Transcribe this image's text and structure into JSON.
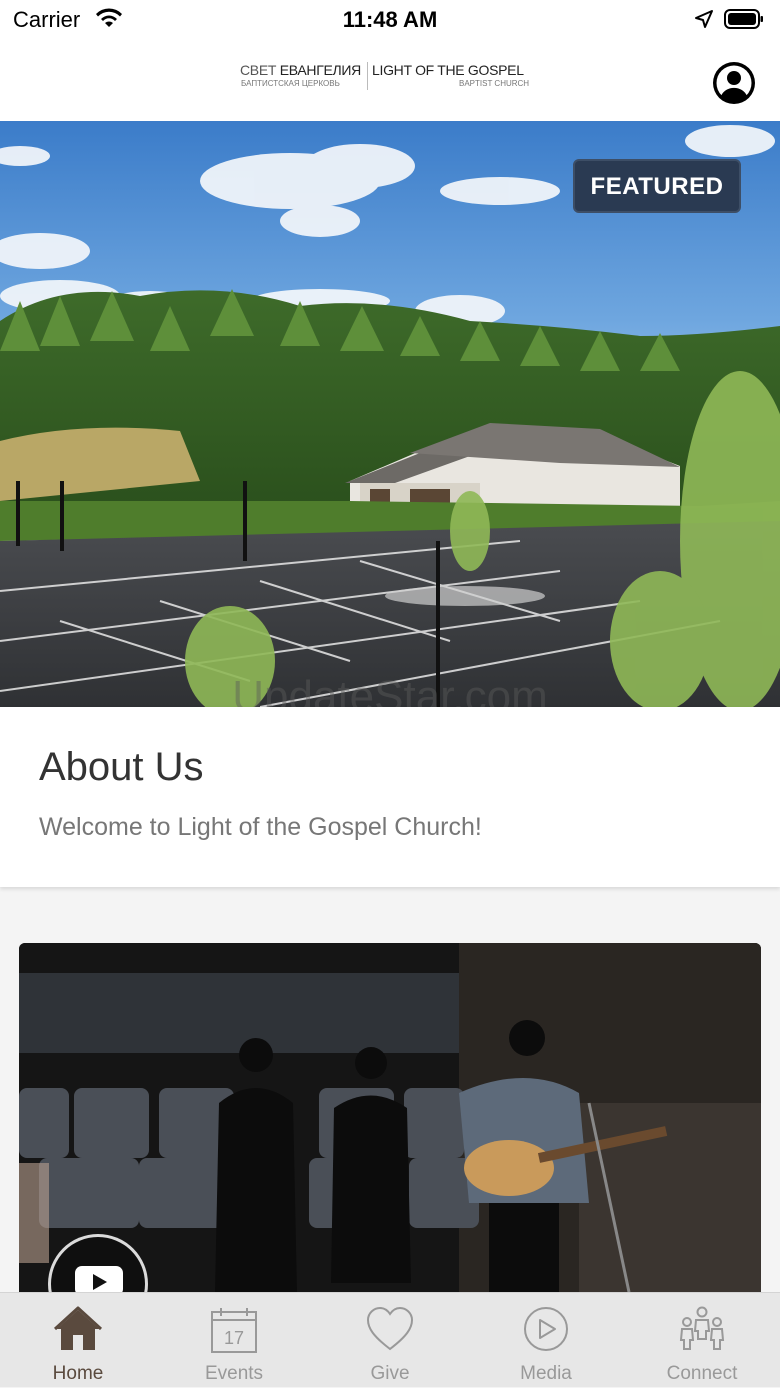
{
  "status_bar": {
    "carrier": "Carrier",
    "time": "11:48 AM"
  },
  "header": {
    "logo": {
      "ru_title_light": "СВЕТ ",
      "ru_title_bold": "ЕВАНГЕЛИЯ",
      "ru_subtitle": "БАПТИСТСКАЯ ЦЕРКОВЬ",
      "en_title": "LIGHT OF THE GOSPEL",
      "en_subtitle": "BAPTIST CHURCH"
    },
    "profile_icon": "person-circle-icon"
  },
  "hero": {
    "badge": "FEATURED",
    "watermark": "UpdateStar.com"
  },
  "about": {
    "title": "About Us",
    "subtitle": "Welcome to Light of the Gospel Church!"
  },
  "video": {
    "play_icon": "youtube-play-icon"
  },
  "tabs": [
    {
      "label": "Home",
      "icon": "home-icon",
      "active": true
    },
    {
      "label": "Events",
      "icon": "calendar-icon",
      "calendar_day": "17",
      "active": false
    },
    {
      "label": "Give",
      "icon": "heart-icon",
      "active": false
    },
    {
      "label": "Media",
      "icon": "play-circle-icon",
      "active": false
    },
    {
      "label": "Connect",
      "icon": "people-icon",
      "active": false
    }
  ],
  "colors": {
    "accent": "#5a4a3e",
    "badge_bg": "#2a3a52",
    "tab_inactive": "#999999"
  }
}
